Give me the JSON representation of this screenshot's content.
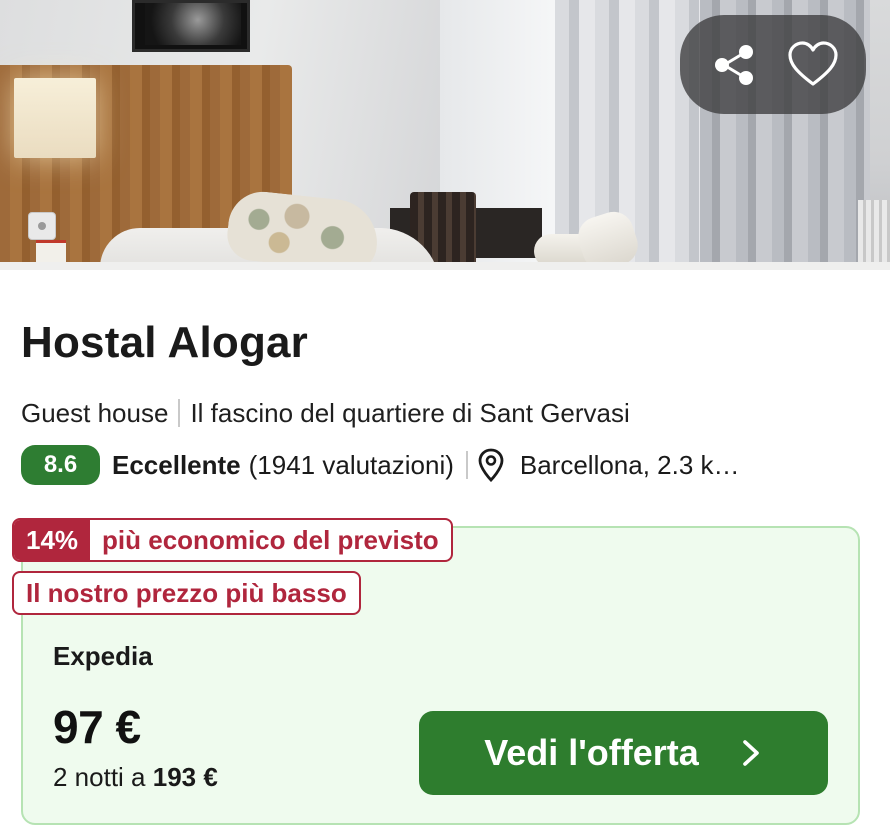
{
  "hotel": {
    "name": "Hostal Alogar",
    "type": "Guest house",
    "tagline": "Il fascino del quartiere di Sant Gervasi",
    "rating": {
      "score": "8.6",
      "label": "Eccellente",
      "reviews": "(1941 valutazioni)"
    },
    "location": "Barcellona, 2.3 k…"
  },
  "actions": {
    "share_icon": "share-icon",
    "favorite_icon": "heart-icon"
  },
  "deal": {
    "discount_pct": "14%",
    "discount_text": "più economico del previsto",
    "lowest_price_text": "Il nostro prezzo più basso",
    "provider": "Expedia",
    "price": "97 €",
    "nights_prefix": "2 notti a ",
    "total": "193 €",
    "cta_label": "Vedi l'offerta"
  },
  "colors": {
    "score_bg": "#2e7d32",
    "badge": "#b0263d",
    "deal_bg": "#effbee",
    "cta_bg": "#2e7d2e"
  }
}
